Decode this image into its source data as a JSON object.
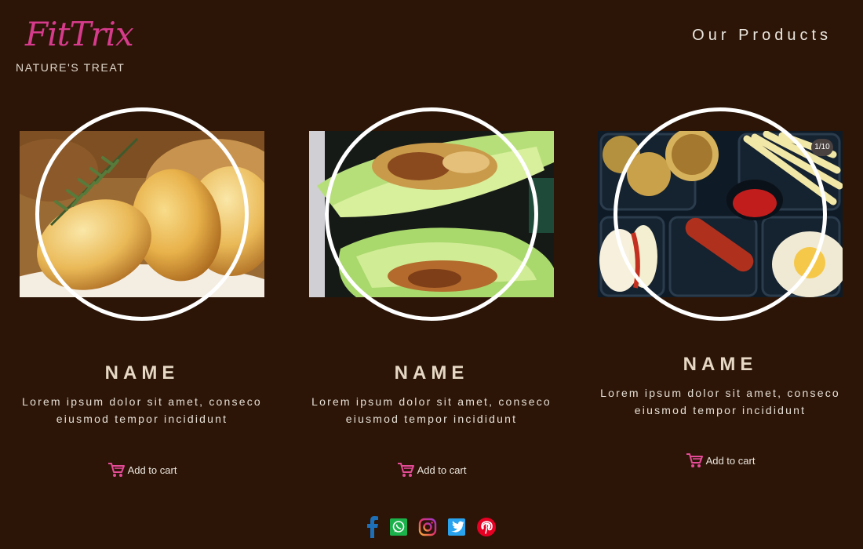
{
  "brand": {
    "name": "FitTrix",
    "tagline": "NATURE'S TREAT",
    "color": "#d63b8c"
  },
  "nav": {
    "title": "Our Products"
  },
  "products": [
    {
      "name": "NAME",
      "description": "Lorem ipsum dolor sit amet, conseco eiusmod tempor incididunt",
      "cart_label": "Add to cart",
      "image": "roasted-potatoes"
    },
    {
      "name": "NAME",
      "description": "Lorem ipsum dolor sit amet, conseco eiusmod tempor incididunt",
      "cart_label": "Add to cart",
      "image": "lettuce-wraps"
    },
    {
      "name": "NAME",
      "description": "Lorem ipsum dolor sit amet, conseco eiusmod tempor incididunt",
      "cart_label": "Add to cart",
      "image": "bento-box",
      "counter": "1/10"
    }
  ],
  "social": [
    {
      "icon": "facebook-icon",
      "color": "#1d6fb8"
    },
    {
      "icon": "whatsapp-icon",
      "color": "#1bb24c"
    },
    {
      "icon": "instagram-icon",
      "color": "#e1306c"
    },
    {
      "icon": "twitter-icon",
      "color": "#2aa3ef"
    },
    {
      "icon": "pinterest-icon",
      "color": "#e60023"
    }
  ],
  "colors": {
    "background": "#2c1507",
    "heading": "#e6d8c4",
    "cart_icon": "#e64b98"
  }
}
